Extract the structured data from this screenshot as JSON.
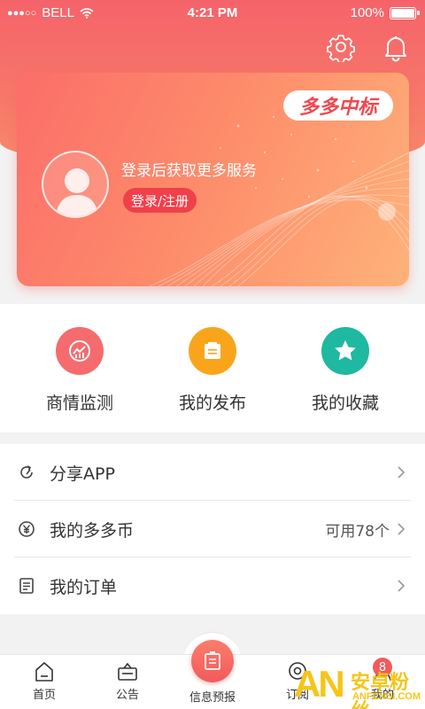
{
  "status_bar": {
    "carrier": "BELL",
    "time": "4:21 PM",
    "battery": "100%"
  },
  "header": {
    "settings_icon": "gear-icon",
    "notifications_icon": "bell-icon"
  },
  "card": {
    "brand": "多多中标",
    "title": "登录后获取更多服务",
    "login_label": "登录/注册"
  },
  "quick_actions": [
    {
      "label": "商情监测",
      "icon": "chart-monitor-icon",
      "color": "#f56b6e"
    },
    {
      "label": "我的发布",
      "icon": "document-icon",
      "color": "#f8a51c"
    },
    {
      "label": "我的收藏",
      "icon": "star-icon",
      "color": "#1fb8a0"
    }
  ],
  "menu": {
    "share": {
      "label": "分享APP",
      "icon": "share-icon"
    },
    "coins": {
      "label": "我的多多币",
      "icon": "yen-coin-icon",
      "extra": "可用78个"
    },
    "orders": {
      "label": "我的订单",
      "icon": "order-list-icon"
    }
  },
  "tab_bar": {
    "home": "首页",
    "notice": "公告",
    "forecast": "信息预报",
    "subscribe": "订阅",
    "mine": "我的",
    "mine_badge": "8"
  },
  "watermark": {
    "logo": "AN",
    "name": "安卓粉丝",
    "url": "ANFENSI.COM"
  },
  "colors": {
    "brand_red": "#f25a5a",
    "accent_orange": "#f8a51c",
    "accent_teal": "#1fb8a0"
  }
}
